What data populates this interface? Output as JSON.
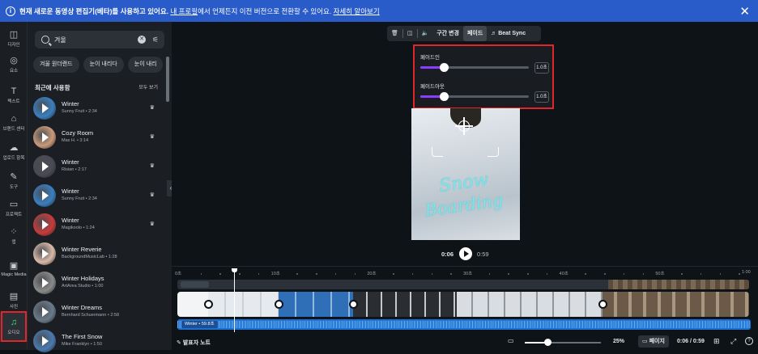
{
  "banner": {
    "bold": "현재 새로운 동영상 편집기(베타)를 사용하고 있어요.",
    "link1": "내 프로필",
    "middle": "에서 언제든지 이전 버전으로 전환할 수 있어요.",
    "link2": "자세히 알아보기"
  },
  "rail": [
    {
      "label": "디자인",
      "icon": "layout-icon"
    },
    {
      "label": "요소",
      "icon": "shapes-icon"
    },
    {
      "label": "텍스트",
      "icon": "text-icon"
    },
    {
      "label": "브랜드 센터",
      "icon": "brand-icon"
    },
    {
      "label": "업로드 항목",
      "icon": "cloud-upload-icon"
    },
    {
      "label": "도구",
      "icon": "pen-icon"
    },
    {
      "label": "프로젝트",
      "icon": "folder-icon"
    },
    {
      "label": "앱",
      "icon": "apps-icon"
    },
    {
      "label": "Magic Media",
      "icon": "magic-icon"
    },
    {
      "label": "사진",
      "icon": "photo-icon"
    },
    {
      "label": "오디오",
      "icon": "music-icon"
    }
  ],
  "search": {
    "value": "겨울"
  },
  "chips": [
    "겨울 원더랜드",
    "눈이 내리다",
    "눈이 내리"
  ],
  "recent": {
    "title": "최근에 사용함",
    "see_all": "모두 보기"
  },
  "tracks": [
    {
      "title": "Winter",
      "sub": "Sunny Fruit • 2:34",
      "color": "#3a7fc0"
    },
    {
      "title": "Cozy Room",
      "sub": "Max H. • 3:14",
      "color": "#c99a7a"
    },
    {
      "title": "Winter",
      "sub": "Risian • 2:17",
      "color": "#4a4a55"
    },
    {
      "title": "Winter",
      "sub": "Sunny Fruit • 2:34",
      "color": "#3a7fc0"
    },
    {
      "title": "Winter",
      "sub": "Magikoolo • 1:24",
      "color": "#c83a3a"
    },
    {
      "title": "Winter Reverie",
      "sub": "BackgroundMusicLab • 1:28",
      "color": "#d8b9a8"
    },
    {
      "title": "Winter Holidays",
      "sub": "ArtArea Studio • 1:00",
      "color": "#8a8a8a"
    },
    {
      "title": "Winter Dreams",
      "sub": "Bernhard Schuermann • 2:58",
      "color": "#6a7a8a"
    },
    {
      "title": "The First Snow",
      "sub": "Mike Franklyn • 1:50",
      "color": "#4a7ab0"
    }
  ],
  "toolbar": {
    "split": "구간 변경",
    "fade": "페이드",
    "beat": "Beat Sync"
  },
  "fade": {
    "in_label": "페이드인",
    "in_value": "1.0초",
    "in_level": 0.22,
    "out_label": "페이드아웃",
    "out_value": "1.0초",
    "out_level": 0.22
  },
  "video": {
    "line1": "Snow",
    "line2": "Boarding"
  },
  "player": {
    "current": "0:06",
    "duration": "0:59"
  },
  "ruler": [
    {
      "label": "0초",
      "pos": 0
    },
    {
      "label": "10초",
      "pos": 10
    },
    {
      "label": "20초",
      "pos": 20
    },
    {
      "label": "30초",
      "pos": 30
    },
    {
      "label": "40초",
      "pos": 40
    },
    {
      "label": "50초",
      "pos": 50
    },
    {
      "label": "1:00",
      "pos": 60
    }
  ],
  "audio_track": {
    "label": "Winter • 59.8초"
  },
  "bottom": {
    "notes": "발표자 노트",
    "zoom": "25%",
    "page": "페이지",
    "time": "0:06 / 0:59",
    "help": "?"
  }
}
